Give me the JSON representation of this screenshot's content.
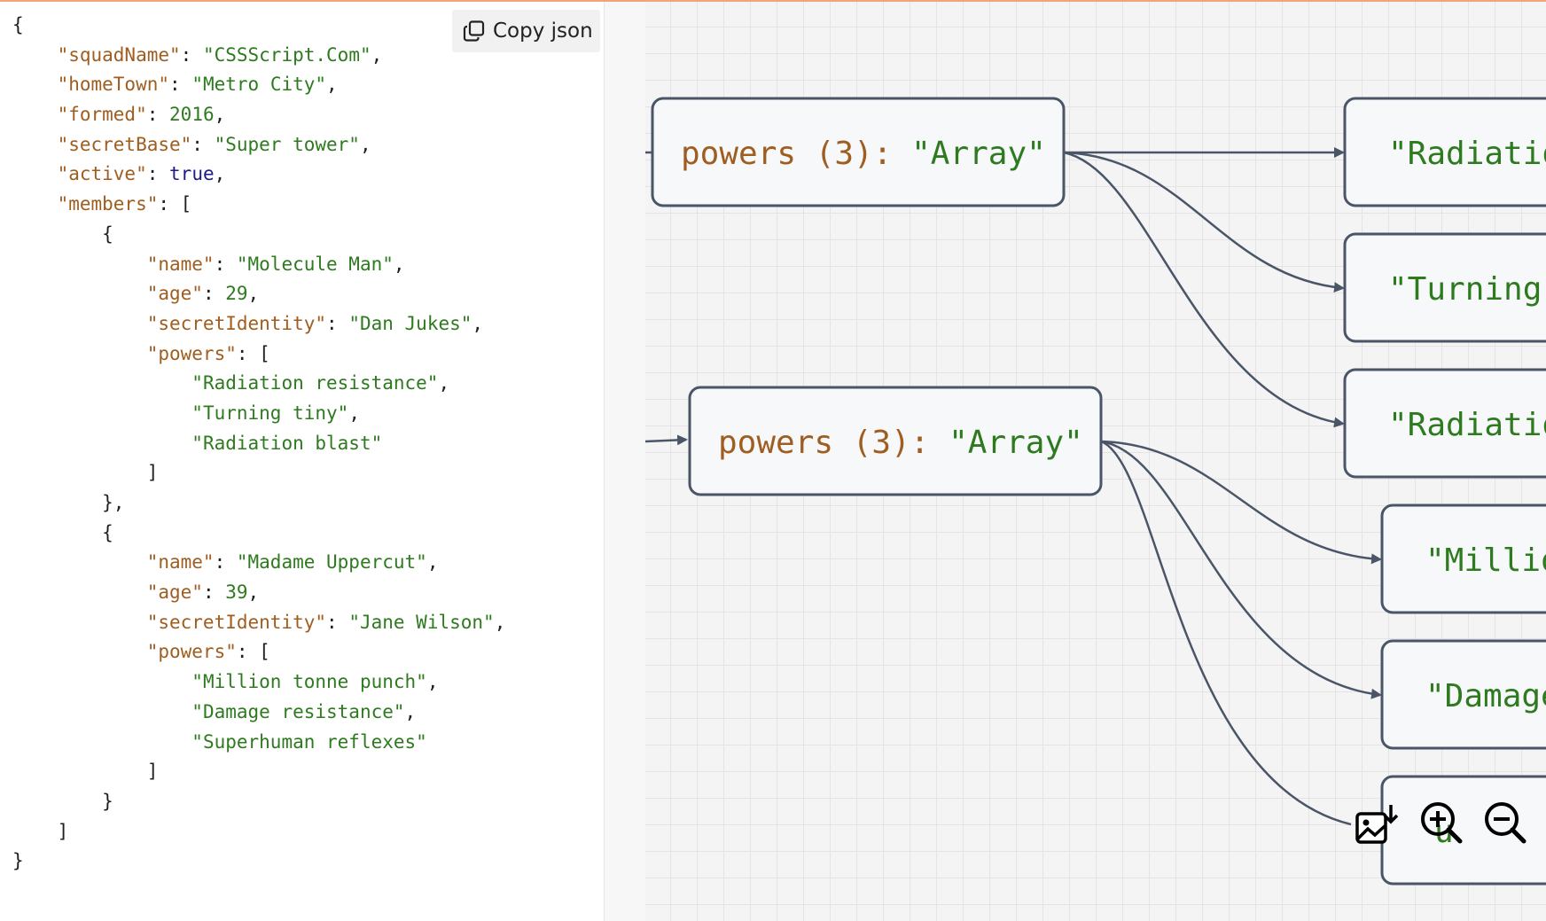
{
  "toolbar": {
    "copy_label": "Copy json"
  },
  "code_lines": [
    [
      {
        "t": "p",
        "v": "{"
      }
    ],
    [
      {
        "t": "p",
        "v": "    "
      },
      {
        "t": "k",
        "v": "\"squadName\""
      },
      {
        "t": "p",
        "v": ": "
      },
      {
        "t": "s",
        "v": "\"CSSScript.Com\""
      },
      {
        "t": "p",
        "v": ","
      }
    ],
    [
      {
        "t": "p",
        "v": "    "
      },
      {
        "t": "k",
        "v": "\"homeTown\""
      },
      {
        "t": "p",
        "v": ": "
      },
      {
        "t": "s",
        "v": "\"Metro City\""
      },
      {
        "t": "p",
        "v": ","
      }
    ],
    [
      {
        "t": "p",
        "v": "    "
      },
      {
        "t": "k",
        "v": "\"formed\""
      },
      {
        "t": "p",
        "v": ": "
      },
      {
        "t": "n",
        "v": "2016"
      },
      {
        "t": "p",
        "v": ","
      }
    ],
    [
      {
        "t": "p",
        "v": "    "
      },
      {
        "t": "k",
        "v": "\"secretBase\""
      },
      {
        "t": "p",
        "v": ": "
      },
      {
        "t": "s",
        "v": "\"Super tower\""
      },
      {
        "t": "p",
        "v": ","
      }
    ],
    [
      {
        "t": "p",
        "v": "    "
      },
      {
        "t": "k",
        "v": "\"active\""
      },
      {
        "t": "p",
        "v": ": "
      },
      {
        "t": "b",
        "v": "true"
      },
      {
        "t": "p",
        "v": ","
      }
    ],
    [
      {
        "t": "p",
        "v": "    "
      },
      {
        "t": "k",
        "v": "\"members\""
      },
      {
        "t": "p",
        "v": ": ["
      }
    ],
    [
      {
        "t": "p",
        "v": "        {"
      }
    ],
    [
      {
        "t": "p",
        "v": "            "
      },
      {
        "t": "k",
        "v": "\"name\""
      },
      {
        "t": "p",
        "v": ": "
      },
      {
        "t": "s",
        "v": "\"Molecule Man\""
      },
      {
        "t": "p",
        "v": ","
      }
    ],
    [
      {
        "t": "p",
        "v": "            "
      },
      {
        "t": "k",
        "v": "\"age\""
      },
      {
        "t": "p",
        "v": ": "
      },
      {
        "t": "n",
        "v": "29"
      },
      {
        "t": "p",
        "v": ","
      }
    ],
    [
      {
        "t": "p",
        "v": "            "
      },
      {
        "t": "k",
        "v": "\"secretIdentity\""
      },
      {
        "t": "p",
        "v": ": "
      },
      {
        "t": "s",
        "v": "\"Dan Jukes\""
      },
      {
        "t": "p",
        "v": ","
      }
    ],
    [
      {
        "t": "p",
        "v": "            "
      },
      {
        "t": "k",
        "v": "\"powers\""
      },
      {
        "t": "p",
        "v": ": ["
      }
    ],
    [
      {
        "t": "p",
        "v": "                "
      },
      {
        "t": "s",
        "v": "\"Radiation resistance\""
      },
      {
        "t": "p",
        "v": ","
      }
    ],
    [
      {
        "t": "p",
        "v": "                "
      },
      {
        "t": "s",
        "v": "\"Turning tiny\""
      },
      {
        "t": "p",
        "v": ","
      }
    ],
    [
      {
        "t": "p",
        "v": "                "
      },
      {
        "t": "s",
        "v": "\"Radiation blast\""
      }
    ],
    [
      {
        "t": "p",
        "v": "            ]"
      }
    ],
    [
      {
        "t": "p",
        "v": "        },"
      }
    ],
    [
      {
        "t": "p",
        "v": "        {"
      }
    ],
    [
      {
        "t": "p",
        "v": "            "
      },
      {
        "t": "k",
        "v": "\"name\""
      },
      {
        "t": "p",
        "v": ": "
      },
      {
        "t": "s",
        "v": "\"Madame Uppercut\""
      },
      {
        "t": "p",
        "v": ","
      }
    ],
    [
      {
        "t": "p",
        "v": "            "
      },
      {
        "t": "k",
        "v": "\"age\""
      },
      {
        "t": "p",
        "v": ": "
      },
      {
        "t": "n",
        "v": "39"
      },
      {
        "t": "p",
        "v": ","
      }
    ],
    [
      {
        "t": "p",
        "v": "            "
      },
      {
        "t": "k",
        "v": "\"secretIdentity\""
      },
      {
        "t": "p",
        "v": ": "
      },
      {
        "t": "s",
        "v": "\"Jane Wilson\""
      },
      {
        "t": "p",
        "v": ","
      }
    ],
    [
      {
        "t": "p",
        "v": "            "
      },
      {
        "t": "k",
        "v": "\"powers\""
      },
      {
        "t": "p",
        "v": ": ["
      }
    ],
    [
      {
        "t": "p",
        "v": "                "
      },
      {
        "t": "s",
        "v": "\"Million tonne punch\""
      },
      {
        "t": "p",
        "v": ","
      }
    ],
    [
      {
        "t": "p",
        "v": "                "
      },
      {
        "t": "s",
        "v": "\"Damage resistance\""
      },
      {
        "t": "p",
        "v": ","
      }
    ],
    [
      {
        "t": "p",
        "v": "                "
      },
      {
        "t": "s",
        "v": "\"Superhuman reflexes\""
      }
    ],
    [
      {
        "t": "p",
        "v": "            ]"
      }
    ],
    [
      {
        "t": "p",
        "v": "        }"
      }
    ],
    [
      {
        "t": "p",
        "v": "    ]"
      }
    ],
    [
      {
        "t": "p",
        "v": "}"
      }
    ]
  ],
  "graph": {
    "parents": [
      {
        "key": "powers (3): ",
        "value": "\"Array\""
      },
      {
        "key": "powers (3): ",
        "value": "\"Array\""
      }
    ],
    "children": [
      {
        "value": "\"Radiatio"
      },
      {
        "value": "\"Turning "
      },
      {
        "value": "\"Radiatio"
      },
      {
        "value": "\"Millio"
      },
      {
        "value": "\"Damage"
      },
      {
        "value": "u"
      }
    ]
  },
  "tools": [
    "download-image-icon",
    "zoom-in-icon",
    "zoom-out-icon"
  ],
  "colors": {
    "key": "#a05d20",
    "string": "#2d7a1f",
    "boolean": "#1b1b8a",
    "node_border": "#4a5568",
    "node_fill": "#f7f8fa",
    "edge": "#4a5568"
  }
}
